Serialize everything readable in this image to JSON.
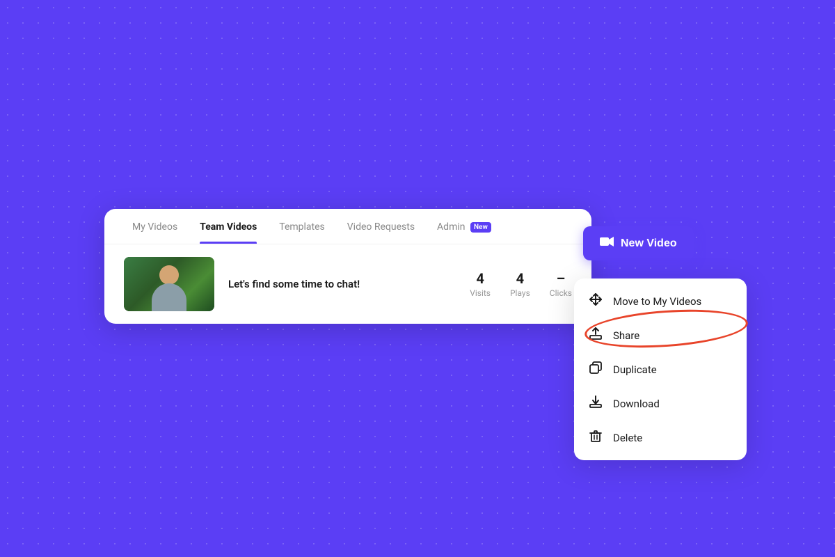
{
  "background": {
    "color": "#5b3ef5"
  },
  "nav": {
    "items": [
      {
        "id": "my-videos",
        "label": "My Videos",
        "active": false
      },
      {
        "id": "team-videos",
        "label": "Team Videos",
        "active": true
      },
      {
        "id": "templates",
        "label": "Templates",
        "active": false
      },
      {
        "id": "video-requests",
        "label": "Video Requests",
        "active": false
      },
      {
        "id": "admin",
        "label": "Admin",
        "active": false,
        "badge": "New"
      }
    ]
  },
  "new_video_button": {
    "label": "New Video",
    "icon": "camera-icon"
  },
  "video_row": {
    "title": "Let's find some time to chat!",
    "stats": [
      {
        "value": "4",
        "label": "Visits"
      },
      {
        "value": "4",
        "label": "Plays"
      },
      {
        "value": "–",
        "label": "Clicks"
      }
    ]
  },
  "dropdown": {
    "items": [
      {
        "id": "move",
        "label": "Move to My Videos",
        "icon": "move-icon"
      },
      {
        "id": "share",
        "label": "Share",
        "icon": "share-icon",
        "highlighted": true
      },
      {
        "id": "duplicate",
        "label": "Duplicate",
        "icon": "duplicate-icon"
      },
      {
        "id": "download",
        "label": "Download",
        "icon": "download-icon"
      },
      {
        "id": "delete",
        "label": "Delete",
        "icon": "delete-icon"
      }
    ]
  }
}
